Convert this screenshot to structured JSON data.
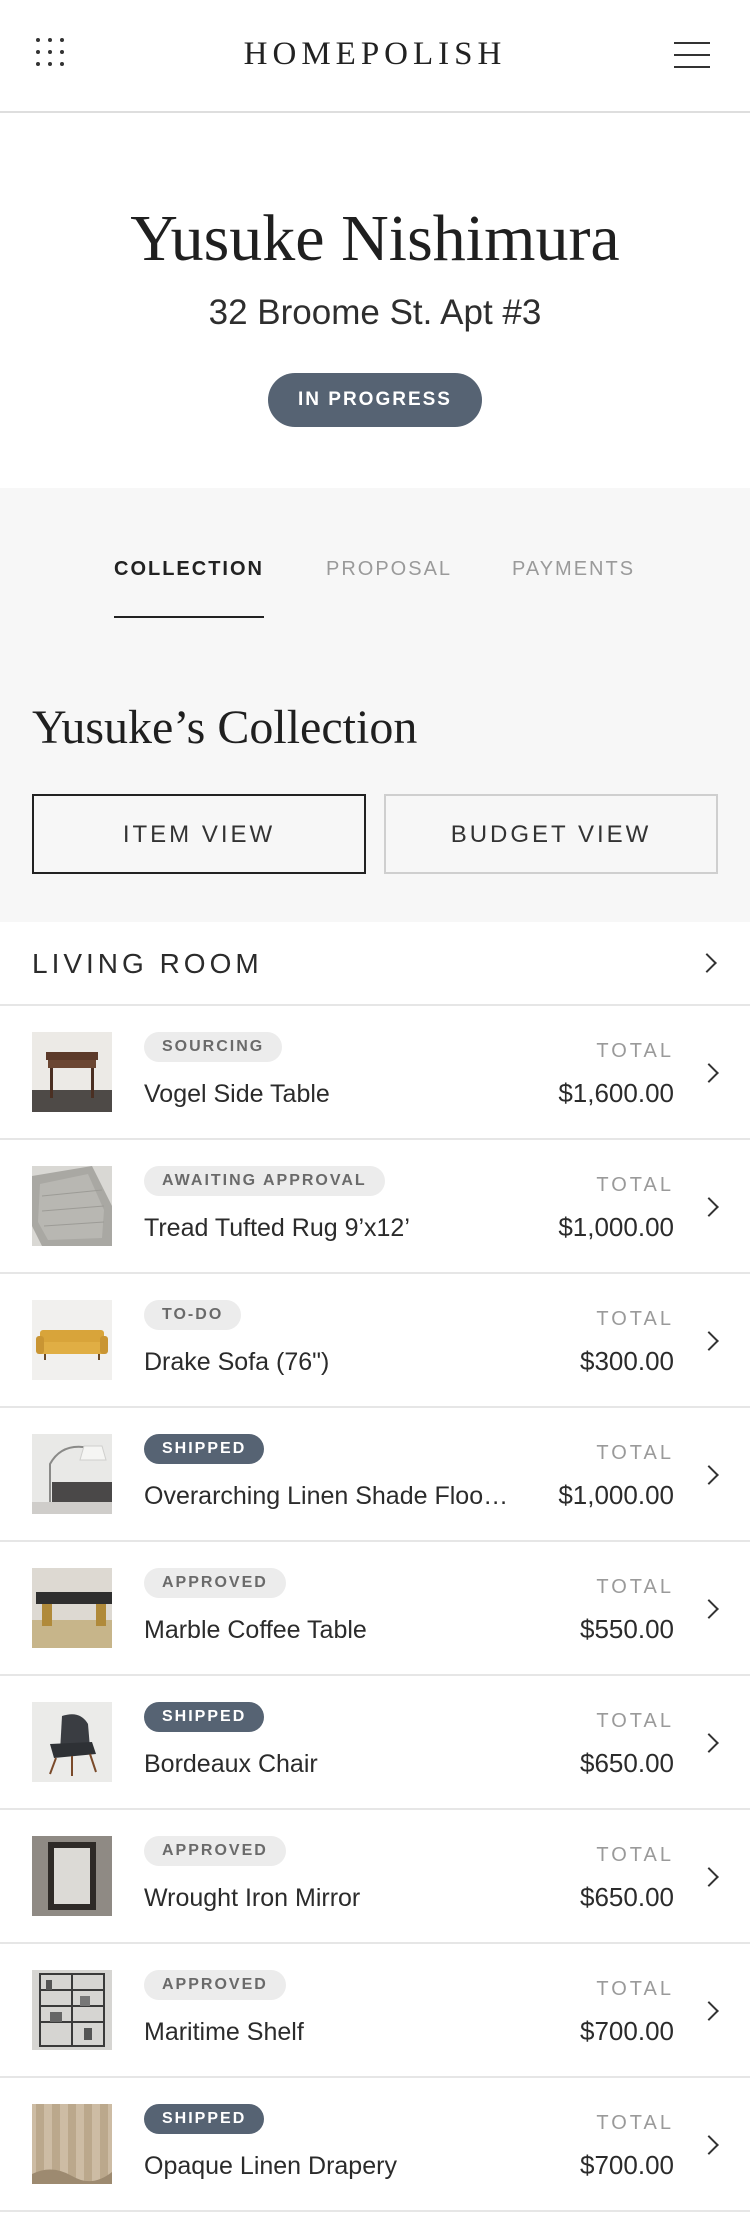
{
  "header": {
    "brand": "HOMEPOLISH",
    "grid_icon": "grid-dots-icon",
    "menu_icon": "hamburger-menu-icon"
  },
  "client": {
    "name": "Yusuke Nishimura",
    "address": "32 Broome St. Apt #3",
    "status": "IN PROGRESS"
  },
  "tabs": [
    {
      "label": "COLLECTION",
      "active": true
    },
    {
      "label": "PROPOSAL",
      "active": false
    },
    {
      "label": "PAYMENTS",
      "active": false
    }
  ],
  "collection": {
    "title": "Yusuke’s Collection",
    "item_view_label": "ITEM VIEW",
    "budget_view_label": "BUDGET VIEW"
  },
  "room": {
    "title": "LIVING ROOM"
  },
  "items": [
    {
      "status": "SOURCING",
      "name": "Vogel Side Table",
      "total_label": "TOTAL",
      "price": "$1,600.00",
      "image": "side-table-image"
    },
    {
      "status": "AWAITING APPROVAL",
      "name": "Tread Tufted Rug 9’x12’",
      "total_label": "TOTAL",
      "price": "$1,000.00",
      "image": "rug-image"
    },
    {
      "status": "TO-DO",
      "name": "Drake Sofa (76\")",
      "total_label": "TOTAL",
      "price": "$300.00",
      "image": "sofa-image"
    },
    {
      "status": "SHIPPED",
      "name": "Overarching Linen Shade Floor…",
      "total_label": "TOTAL",
      "price": "$1,000.00",
      "image": "floor-lamp-image"
    },
    {
      "status": "APPROVED",
      "name": "Marble Coffee Table",
      "total_label": "TOTAL",
      "price": "$550.00",
      "image": "coffee-table-image"
    },
    {
      "status": "SHIPPED",
      "name": "Bordeaux Chair",
      "total_label": "TOTAL",
      "price": "$650.00",
      "image": "chair-image"
    },
    {
      "status": "APPROVED",
      "name": "Wrought Iron Mirror",
      "total_label": "TOTAL",
      "price": "$650.00",
      "image": "mirror-image"
    },
    {
      "status": "APPROVED",
      "name": "Maritime Shelf",
      "total_label": "TOTAL",
      "price": "$700.00",
      "image": "shelf-image"
    },
    {
      "status": "SHIPPED",
      "name": "Opaque Linen Drapery",
      "total_label": "TOTAL",
      "price": "$700.00",
      "image": "drapery-image"
    }
  ],
  "colors": {
    "status_dark": "#566373",
    "status_light": "#ececec",
    "section_bg": "#f7f7f7"
  }
}
